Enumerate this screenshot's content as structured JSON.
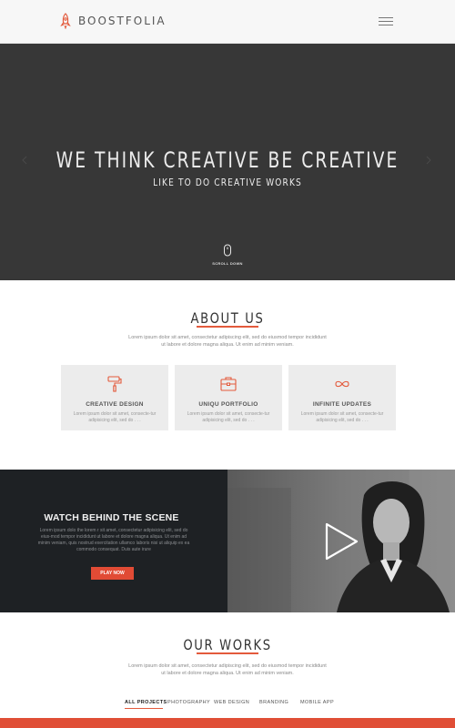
{
  "header": {
    "brand": "BOOSTFOLIA",
    "logo_icon": "rocket-icon",
    "menu_icon": "hamburger-menu-icon"
  },
  "hero": {
    "title": "WE THINK CREATIVE BE CREATIVE",
    "subtitle": "LIKE TO DO CREATIVE WORKS",
    "scroll_label": "SCROLL DOWN",
    "scroll_icon": "mouse-icon"
  },
  "about": {
    "title": "ABOUT US",
    "description": "Lorem ipsum dolor sit amet, consectetur adipiscing elit, sed do eiusmod tempor incididunt ut labore et dolore magna aliqua. Ut enim ad minim veniam.",
    "cards": [
      {
        "icon": "paint-roller-icon",
        "title": "CREATIVE DESIGN",
        "text": "Lorem ipsum dolor sit amet, consecte-tur adipisicing elit, sed do . . ."
      },
      {
        "icon": "briefcase-icon",
        "title": "UNIQU PORTFOLIO",
        "text": "Lorem ipsum dolor sit amet, consecte-tur adipisicing elit, sed do . . ."
      },
      {
        "icon": "infinity-icon",
        "title": "INFINITE UPDATES",
        "text": "Lorem ipsum dolor sit amet, consecte-tur adipisicing elit, sed do . . ."
      }
    ]
  },
  "video": {
    "title": "WATCH BEHIND THE SCENE",
    "text": "Lorem ipsum dolo the lorem r sit amet, consectetur adipisicing elit, sed do eius-mod tempor incididunt ut labore et dolore magna aliqua. Ut enim ad minim veniam, quis nostrud exercitation ullamco laboris nisi ut aliquip ex ea commodo consequat. Duis aute irure",
    "button": "PLAY NOW",
    "play_icon": "play-icon"
  },
  "works": {
    "title": "OUR WORKS",
    "description": "Lorem ipsum dolor sit amet, consectetur adipiscing elit, sed do eiusmod tempor incididunt ut labore et dolore magna aliqua. Ut enim ad minim veniam.",
    "filters": [
      "ALL PROJECTS",
      "PHOTOGRAPHY",
      "WEB DESIGN",
      "BRANDING",
      "MOBILE APP"
    ]
  },
  "colors": {
    "accent": "#e35a3c",
    "hero_bg": "#373737",
    "video_bg": "#1e2124",
    "card_bg": "#ececec"
  }
}
